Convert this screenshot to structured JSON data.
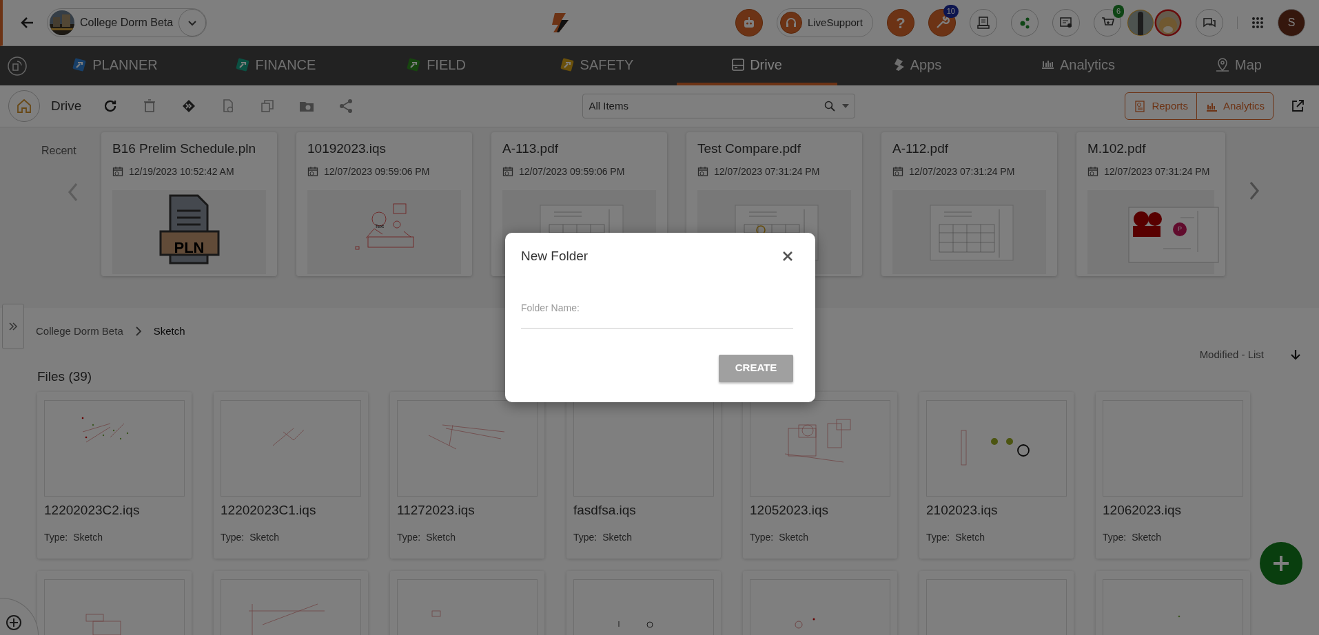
{
  "top_bar": {
    "project": "College Dorm Beta",
    "live_support": "LiveSupport",
    "help": "?",
    "notification_badge": "10",
    "cart_badge": "6",
    "user_initial": "S"
  },
  "modules": [
    {
      "label": "PLANNER",
      "kind": "module",
      "selected": false
    },
    {
      "label": "FINANCE",
      "kind": "module",
      "selected": false
    },
    {
      "label": "FIELD",
      "kind": "module",
      "selected": false
    },
    {
      "label": "SAFETY",
      "kind": "module",
      "selected": false
    },
    {
      "label": "Drive",
      "kind": "section",
      "selected": true
    },
    {
      "label": "Apps",
      "kind": "section",
      "selected": false
    },
    {
      "label": "Analytics",
      "kind": "section",
      "selected": false
    },
    {
      "label": "Map",
      "kind": "section",
      "selected": false
    }
  ],
  "toolbar": {
    "title": "Drive",
    "search": {
      "value": "All Items"
    },
    "buttons": [
      "Reports",
      "Analytics"
    ]
  },
  "recent": {
    "label": "Recent",
    "items": [
      {
        "name": "B16 Prelim Schedule.pln",
        "modified": "12/19/2023 10:52:42 AM",
        "kind": "pln",
        "badge_text": "PLN"
      },
      {
        "name": "10192023.iqs",
        "modified": "12/07/2023 09:59:06 PM",
        "kind": "sketch",
        "thumb_text": "Text"
      },
      {
        "name": "A-113.pdf",
        "modified": "12/07/2023 09:59:06 PM",
        "kind": "plan"
      },
      {
        "name": "Test Compare.pdf",
        "modified": "12/07/2023 07:31:24 PM",
        "kind": "plan"
      },
      {
        "name": "A-112.pdf",
        "modified": "12/07/2023 07:31:24 PM",
        "kind": "plan"
      },
      {
        "name": "M.102.pdf",
        "modified": "12/07/2023 07:31:24 PM",
        "kind": "markup",
        "thumb_text": "P"
      }
    ]
  },
  "breadcrumb": [
    {
      "label": "College Dorm Beta",
      "selected": false
    },
    {
      "label": "Sketch",
      "selected": true
    }
  ],
  "sort": "Modified - List",
  "files": {
    "title": "Files (39)",
    "items": [
      {
        "name": "12202023C2.iqs",
        "type_label": "Type:",
        "type": "Sketch"
      },
      {
        "name": "12202023C1.iqs",
        "type_label": "Type:",
        "type": "Sketch"
      },
      {
        "name": "11272023.iqs",
        "type_label": "Type:",
        "type": "Sketch"
      },
      {
        "name": "fasdfsa.iqs",
        "type_label": "Type:",
        "type": "Sketch"
      },
      {
        "name": "12052023.iqs",
        "type_label": "Type:",
        "type": "Sketch"
      },
      {
        "name": "2102023.iqs",
        "type_label": "Type:",
        "type": "Sketch"
      },
      {
        "name": "12062023.iqs",
        "type_label": "Type:",
        "type": "Sketch"
      },
      {
        "kind": "cut"
      },
      {
        "kind": "cut"
      },
      {
        "kind": "cut"
      },
      {
        "kind": "cut"
      },
      {
        "kind": "cut"
      },
      {
        "kind": "cut"
      },
      {
        "kind": "cut"
      }
    ]
  },
  "dialog": {
    "title": "New Folder",
    "field_label": "Folder Name:",
    "button": "CREATE"
  }
}
